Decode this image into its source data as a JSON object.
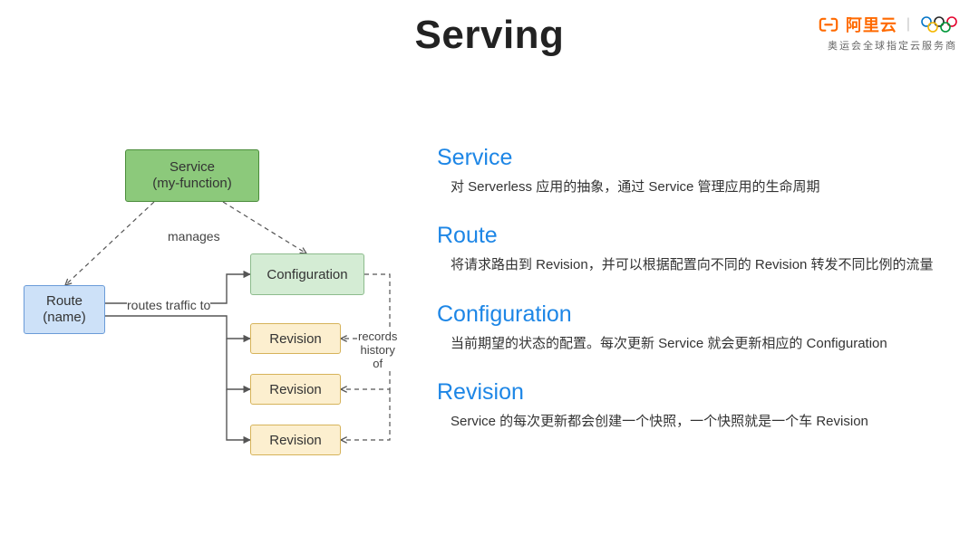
{
  "title": "Serving",
  "brand": {
    "name": "阿里云",
    "tagline": "奥运会全球指定云服务商"
  },
  "diagram": {
    "service": {
      "line1": "Service",
      "line2": "(my-function)"
    },
    "route": {
      "line1": "Route",
      "line2": "(name)"
    },
    "configuration": {
      "label": "Configuration"
    },
    "revisions": [
      "Revision",
      "Revision",
      "Revision"
    ],
    "labels": {
      "manages": "manages",
      "routes": "routes traffic to",
      "records": "records\nhistory\nof"
    }
  },
  "sections": [
    {
      "heading": "Service",
      "body": "对 Serverless 应用的抽象，通过 Service 管理应用的生命周期"
    },
    {
      "heading": "Route",
      "body": "将请求路由到 Revision，并可以根据配置向不同的 Revision 转发不同比例的流量"
    },
    {
      "heading": "Configuration",
      "body": "当前期望的状态的配置。每次更新 Service 就会更新相应的 Configuration"
    },
    {
      "heading": "Revision",
      "body": "Service 的每次更新都会创建一个快照，一个快照就是一个车 Revision"
    }
  ]
}
